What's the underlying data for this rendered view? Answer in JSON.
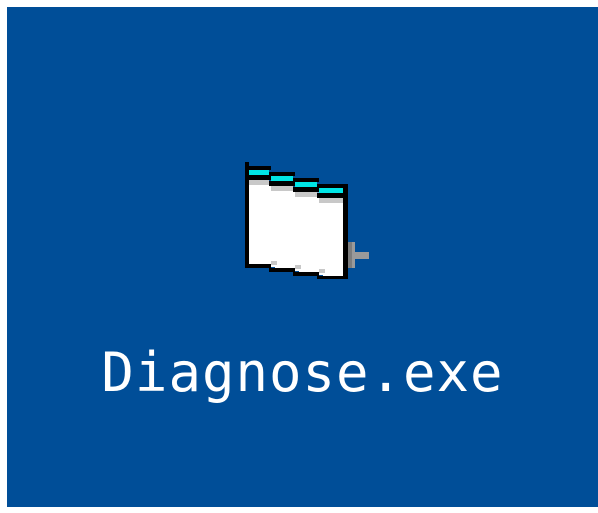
{
  "desktop": {
    "background_color": "#004e98",
    "icon": {
      "name": "diagnose-exe",
      "label": "Diagnose.exe",
      "icon_type": "executable-window-icon",
      "label_color": "#ffffff"
    }
  }
}
